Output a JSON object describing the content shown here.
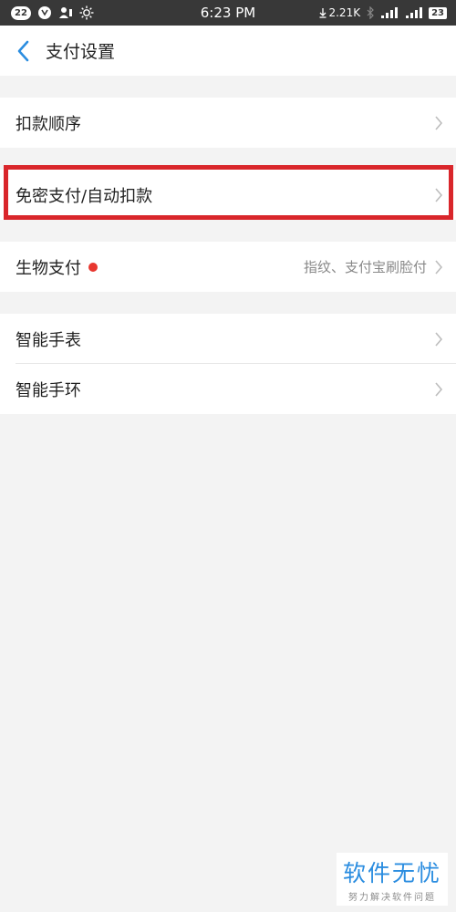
{
  "status_bar": {
    "notif_count": "22",
    "time": "6:23 PM",
    "net_speed": "2.21K",
    "battery": "23"
  },
  "header": {
    "title": "支付设置"
  },
  "settings": {
    "deduction_order": {
      "label": "扣款顺序"
    },
    "auto_pay": {
      "label": "免密支付/自动扣款"
    },
    "biometric": {
      "label": "生物支付",
      "subtitle": "指纹、支付宝刷脸付"
    },
    "smartwatch": {
      "label": "智能手表"
    },
    "smartband": {
      "label": "智能手环"
    }
  },
  "watermark": {
    "title": "软件无忧",
    "subtitle": "努力解决软件问题"
  },
  "colors": {
    "accent": "#2b8de0",
    "highlight": "#d9262b",
    "badge_dot": "#e8372f",
    "background": "#f3f3f3"
  }
}
